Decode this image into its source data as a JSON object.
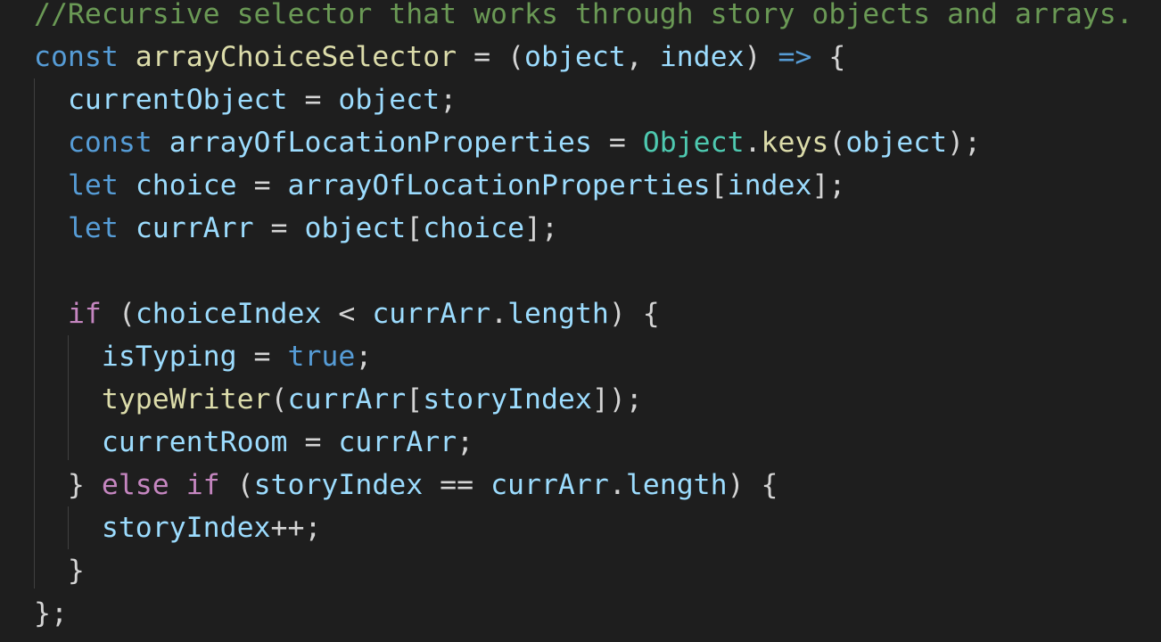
{
  "editor": {
    "theme_colors": {
      "background": "#1e1e1e",
      "comment": "#6a9955",
      "keyword": "#569cd6",
      "control": "#c586c0",
      "function": "#dcdcaa",
      "variable": "#9cdcfe",
      "class": "#4ec9b0",
      "punctuation": "#d4d4d4"
    },
    "lines": [
      {
        "tokens": [
          {
            "t": "//Recursive selector that works through story objects and arrays.",
            "c": "cm"
          }
        ]
      },
      {
        "tokens": [
          {
            "t": "const",
            "c": "kw"
          },
          {
            "t": " ",
            "c": "punc"
          },
          {
            "t": "arrayChoiceSelector",
            "c": "fn"
          },
          {
            "t": " = (",
            "c": "punc"
          },
          {
            "t": "object",
            "c": "var"
          },
          {
            "t": ", ",
            "c": "punc"
          },
          {
            "t": "index",
            "c": "var"
          },
          {
            "t": ") ",
            "c": "punc"
          },
          {
            "t": "=>",
            "c": "kw"
          },
          {
            "t": " {",
            "c": "punc"
          }
        ]
      },
      {
        "tokens": [
          {
            "t": "  ",
            "c": "punc"
          },
          {
            "t": "currentObject",
            "c": "var"
          },
          {
            "t": " = ",
            "c": "punc"
          },
          {
            "t": "object",
            "c": "var"
          },
          {
            "t": ";",
            "c": "punc"
          }
        ]
      },
      {
        "tokens": [
          {
            "t": "  ",
            "c": "punc"
          },
          {
            "t": "const",
            "c": "kw"
          },
          {
            "t": " ",
            "c": "punc"
          },
          {
            "t": "arrayOfLocationProperties",
            "c": "var"
          },
          {
            "t": " = ",
            "c": "punc"
          },
          {
            "t": "Object",
            "c": "cls"
          },
          {
            "t": ".",
            "c": "punc"
          },
          {
            "t": "keys",
            "c": "fn"
          },
          {
            "t": "(",
            "c": "punc"
          },
          {
            "t": "object",
            "c": "var"
          },
          {
            "t": ");",
            "c": "punc"
          }
        ]
      },
      {
        "tokens": [
          {
            "t": "  ",
            "c": "punc"
          },
          {
            "t": "let",
            "c": "kw"
          },
          {
            "t": " ",
            "c": "punc"
          },
          {
            "t": "choice",
            "c": "var"
          },
          {
            "t": " = ",
            "c": "punc"
          },
          {
            "t": "arrayOfLocationProperties",
            "c": "var"
          },
          {
            "t": "[",
            "c": "punc"
          },
          {
            "t": "index",
            "c": "var"
          },
          {
            "t": "];",
            "c": "punc"
          }
        ]
      },
      {
        "tokens": [
          {
            "t": "  ",
            "c": "punc"
          },
          {
            "t": "let",
            "c": "kw"
          },
          {
            "t": " ",
            "c": "punc"
          },
          {
            "t": "currArr",
            "c": "var"
          },
          {
            "t": " = ",
            "c": "punc"
          },
          {
            "t": "object",
            "c": "var"
          },
          {
            "t": "[",
            "c": "punc"
          },
          {
            "t": "choice",
            "c": "var"
          },
          {
            "t": "];",
            "c": "punc"
          }
        ]
      },
      {
        "tokens": [
          {
            "t": "",
            "c": "punc"
          }
        ]
      },
      {
        "tokens": [
          {
            "t": "  ",
            "c": "punc"
          },
          {
            "t": "if",
            "c": "ctl"
          },
          {
            "t": " (",
            "c": "punc"
          },
          {
            "t": "choiceIndex",
            "c": "var"
          },
          {
            "t": " < ",
            "c": "punc"
          },
          {
            "t": "currArr",
            "c": "var"
          },
          {
            "t": ".",
            "c": "punc"
          },
          {
            "t": "length",
            "c": "var"
          },
          {
            "t": ") {",
            "c": "punc"
          }
        ]
      },
      {
        "tokens": [
          {
            "t": "    ",
            "c": "punc"
          },
          {
            "t": "isTyping",
            "c": "var"
          },
          {
            "t": " = ",
            "c": "punc"
          },
          {
            "t": "true",
            "c": "kw"
          },
          {
            "t": ";",
            "c": "punc"
          }
        ]
      },
      {
        "tokens": [
          {
            "t": "    ",
            "c": "punc"
          },
          {
            "t": "typeWriter",
            "c": "fn"
          },
          {
            "t": "(",
            "c": "punc"
          },
          {
            "t": "currArr",
            "c": "var"
          },
          {
            "t": "[",
            "c": "punc"
          },
          {
            "t": "storyIndex",
            "c": "var"
          },
          {
            "t": "]);",
            "c": "punc"
          }
        ]
      },
      {
        "tokens": [
          {
            "t": "    ",
            "c": "punc"
          },
          {
            "t": "currentRoom",
            "c": "var"
          },
          {
            "t": " = ",
            "c": "punc"
          },
          {
            "t": "currArr",
            "c": "var"
          },
          {
            "t": ";",
            "c": "punc"
          }
        ]
      },
      {
        "tokens": [
          {
            "t": "  } ",
            "c": "punc"
          },
          {
            "t": "else",
            "c": "ctl"
          },
          {
            "t": " ",
            "c": "punc"
          },
          {
            "t": "if",
            "c": "ctl"
          },
          {
            "t": " (",
            "c": "punc"
          },
          {
            "t": "storyIndex",
            "c": "var"
          },
          {
            "t": " == ",
            "c": "punc"
          },
          {
            "t": "currArr",
            "c": "var"
          },
          {
            "t": ".",
            "c": "punc"
          },
          {
            "t": "length",
            "c": "var"
          },
          {
            "t": ") {",
            "c": "punc"
          }
        ]
      },
      {
        "tokens": [
          {
            "t": "    ",
            "c": "punc"
          },
          {
            "t": "storyIndex",
            "c": "var"
          },
          {
            "t": "++;",
            "c": "punc"
          }
        ]
      },
      {
        "tokens": [
          {
            "t": "  }",
            "c": "punc"
          }
        ]
      },
      {
        "tokens": [
          {
            "t": "};",
            "c": "punc"
          }
        ]
      }
    ]
  }
}
